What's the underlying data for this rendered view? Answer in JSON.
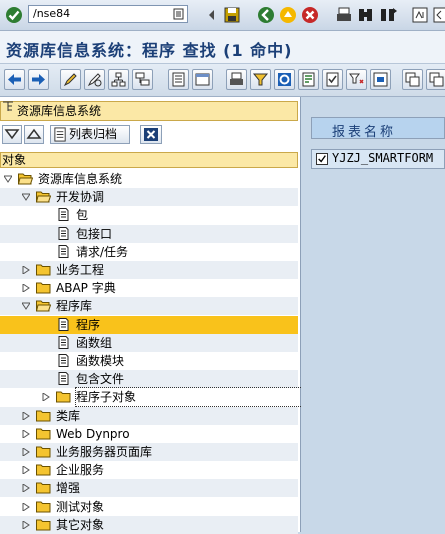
{
  "system_toolbar": {
    "command_field": "/nse84",
    "icons": [
      "enter-icon",
      "history-icon",
      "back-arrow-icon",
      "save-icon",
      "back-icon",
      "exit-icon",
      "cancel-icon",
      "print-icon",
      "find-icon",
      "find-next-icon",
      "first-page-icon"
    ]
  },
  "title": "资源库信息系统：程序 查找 (1 命中)",
  "app_toolbar": {
    "icons": [
      "previous-object-icon",
      "next-object-icon",
      "edit-icon",
      "display-icon",
      "hierarchy-icon",
      "where-used-icon",
      "print-list-icon",
      "local-list-icon",
      "print-icon",
      "filter-icon",
      "refresh-icon",
      "details-icon",
      "select-icon",
      "sort-icon",
      "copy-icon",
      "delete-icon"
    ]
  },
  "left_panel": {
    "header": "资源库信息系统",
    "buttons": {
      "expand": "",
      "collapse": "",
      "list_archive": "列表归档",
      "close": ""
    },
    "column_header": "对象",
    "tree": [
      {
        "label": "资源库信息系统",
        "level": 0,
        "expander": "open",
        "icon": "folder-open-icon"
      },
      {
        "label": "开发协调",
        "level": 1,
        "expander": "open",
        "icon": "folder-open-icon"
      },
      {
        "label": "包",
        "level": 2,
        "expander": "none",
        "icon": "document-icon"
      },
      {
        "label": "包接口",
        "level": 2,
        "expander": "none",
        "icon": "document-icon"
      },
      {
        "label": "请求/任务",
        "level": 2,
        "expander": "none",
        "icon": "document-icon"
      },
      {
        "label": "业务工程",
        "level": 1,
        "expander": "closed",
        "icon": "folder-icon"
      },
      {
        "label": "ABAP 字典",
        "level": 1,
        "expander": "closed",
        "icon": "folder-icon"
      },
      {
        "label": "程序库",
        "level": 1,
        "expander": "open",
        "icon": "folder-open-icon"
      },
      {
        "label": "程序",
        "level": 2,
        "expander": "none",
        "icon": "document-icon",
        "selected": true
      },
      {
        "label": "函数组",
        "level": 2,
        "expander": "none",
        "icon": "document-icon"
      },
      {
        "label": "函数模块",
        "level": 2,
        "expander": "none",
        "icon": "document-icon"
      },
      {
        "label": "包含文件",
        "level": 2,
        "expander": "none",
        "icon": "document-icon"
      },
      {
        "label": "程序子对象",
        "level": 2,
        "expander": "closed",
        "icon": "folder-icon",
        "focus": true
      },
      {
        "label": "类库",
        "level": 1,
        "expander": "closed",
        "icon": "folder-icon"
      },
      {
        "label": "Web Dynpro",
        "level": 1,
        "expander": "closed",
        "icon": "folder-icon"
      },
      {
        "label": "业务服务器页面库",
        "level": 1,
        "expander": "closed",
        "icon": "folder-icon"
      },
      {
        "label": "企业服务",
        "level": 1,
        "expander": "closed",
        "icon": "folder-icon"
      },
      {
        "label": "增强",
        "level": 1,
        "expander": "closed",
        "icon": "folder-icon"
      },
      {
        "label": "测试对象",
        "level": 1,
        "expander": "closed",
        "icon": "folder-icon"
      },
      {
        "label": "其它对象",
        "level": 1,
        "expander": "closed",
        "icon": "folder-icon"
      }
    ]
  },
  "right_panel": {
    "column_header": "报表名称",
    "rows": [
      {
        "checked": true,
        "name": "YJZJ_SMARTFORM"
      }
    ]
  },
  "colors": {
    "title": "#1b3f77",
    "selected_row": "#f9c21b",
    "panel_header": "#fbe8a6",
    "folder": "#f4c430"
  }
}
